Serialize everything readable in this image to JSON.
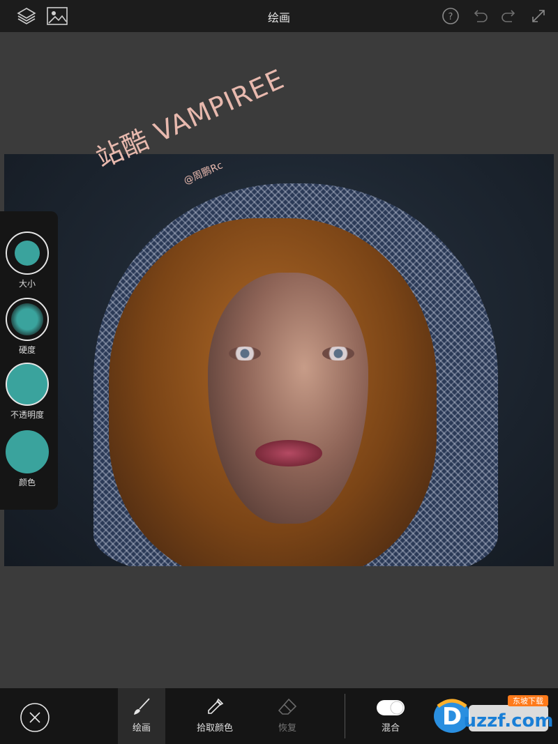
{
  "header": {
    "title": "绘画",
    "icons": [
      "layers-icon",
      "image-icon",
      "help-icon",
      "undo-icon",
      "redo-icon",
      "fullscreen-icon"
    ]
  },
  "canvas": {
    "watermark_main": "站酷 VAMPIREE",
    "watermark_sub": "@周鹏Rc"
  },
  "brush_panel": {
    "items": [
      {
        "label": "大小",
        "icon": "size-icon"
      },
      {
        "label": "硬度",
        "icon": "hardness-icon"
      },
      {
        "label": "不透明度",
        "icon": "opacity-icon"
      },
      {
        "label": "颜色",
        "icon": "color-icon"
      }
    ],
    "accent_color": "#3aa39d"
  },
  "toolbar": {
    "items": [
      {
        "label": "绘画",
        "icon": "brush-icon",
        "active": true
      },
      {
        "label": "拾取颜色",
        "icon": "eyedropper-icon",
        "active": false
      },
      {
        "label": "恢复",
        "icon": "eraser-icon",
        "active": false,
        "disabled": true
      },
      {
        "label": "混合",
        "icon": "toggle-icon",
        "active": false
      }
    ]
  },
  "logo": {
    "text": "uzzf.com",
    "sub": "东坡下载"
  }
}
